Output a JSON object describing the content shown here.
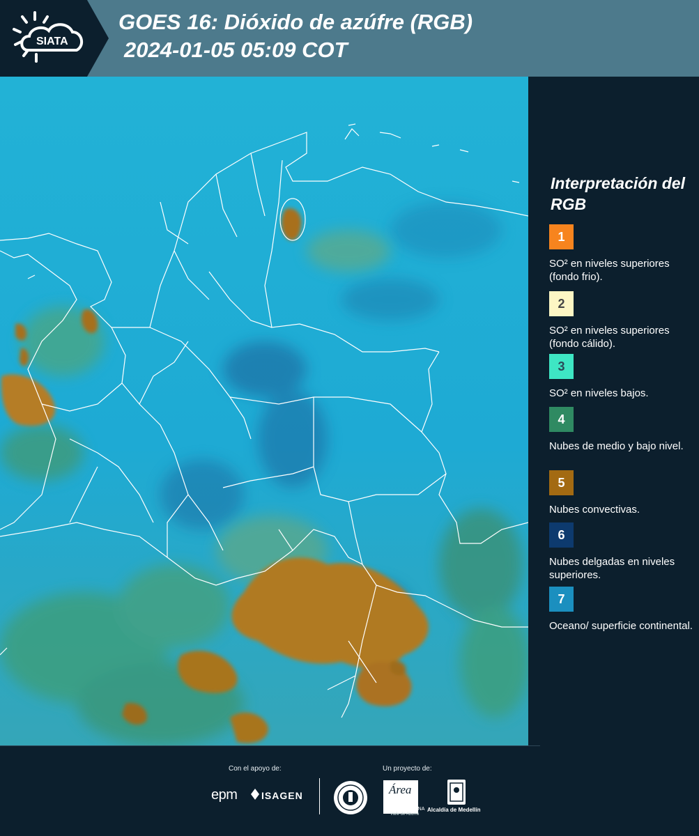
{
  "header": {
    "brand": "SIATA",
    "title_line1": "GOES 16: Dióxido de azúfre (RGB)",
    "title_line2": " 2024-01-05 05:09 COT",
    "colors": {
      "bar": "#4d7a8c",
      "logo_panel": "#0c1f2d"
    }
  },
  "legend": {
    "title": "Interpretación del RGB",
    "items": [
      {
        "number": "1",
        "label": "SO² en niveles superiores (fondo frio).",
        "color": "#f7841e"
      },
      {
        "number": "2",
        "label": "SO² en niveles superiores (fondo cálido).",
        "color": "#fdf6c4"
      },
      {
        "number": "3",
        "label": "SO² en niveles bajos.",
        "color": "#3ee6c4"
      },
      {
        "number": "4",
        "label": "Nubes de medio y bajo nivel.",
        "color": "#2f8a62"
      },
      {
        "number": "5",
        "label": "Nubes convectivas.",
        "color": "#a36a12"
      },
      {
        "number": "6",
        "label": "Nubes delgadas en niveles superiores.",
        "color": "#0d3a6e"
      },
      {
        "number": "7",
        "label": "Oceano/ superficie continental.",
        "color": "#1b8fbf"
      }
    ]
  },
  "map": {
    "image_colors": {
      "background": "#1ab0d8",
      "convective": "#b07a22",
      "low_clouds": "#3e9e7a",
      "thin_high": "#1a6fa6",
      "borders": "#ffffff"
    }
  },
  "footer": {
    "support_label": "Con el apoyo de:",
    "project_label": "Un proyecto de:",
    "sponsors": [
      "epm",
      "ISAGEN"
    ],
    "partners": [
      "Área Metropolitana Valle de Aburrá",
      "Alcaldía de Medellín"
    ],
    "epm_text": "epm",
    "isagen_text": "ISAGEN",
    "area_word": "Área",
    "area_sub1": "METROPOLITANA",
    "area_sub2": "Valle de Aburrá",
    "alcaldia_text": "Alcaldía de Medellín"
  }
}
